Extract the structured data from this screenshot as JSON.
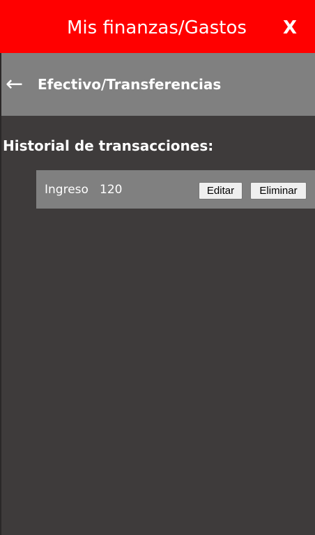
{
  "header": {
    "title": "Mis finanzas/Gastos",
    "close_label": "X",
    "background_color": "#ff0000"
  },
  "subheader": {
    "back_icon": "←",
    "title": "Efectivo/Transferencias",
    "background_color": "#808080"
  },
  "history": {
    "title": "Historial de transacciones:",
    "transactions": [
      {
        "type": "Ingreso",
        "amount": "120",
        "edit_label": "Editar",
        "delete_label": "Eliminar"
      }
    ]
  },
  "colors": {
    "page_background": "#3e3b3b"
  }
}
